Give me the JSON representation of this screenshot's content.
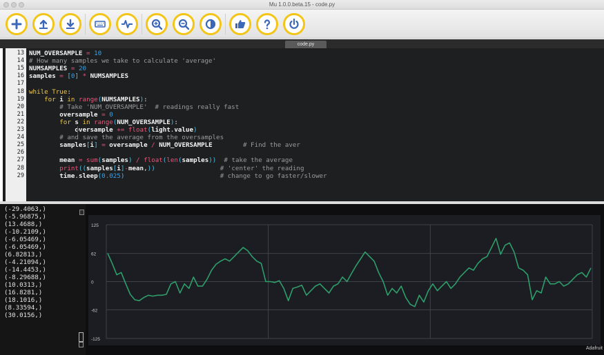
{
  "window": {
    "title": "Mu 1.0.0.beta.15 - code.py"
  },
  "toolbar": {
    "buttons": [
      {
        "name": "new",
        "icon": "plus-icon"
      },
      {
        "name": "load",
        "icon": "upload-icon"
      },
      {
        "name": "save",
        "icon": "download-icon"
      },
      {
        "name": "serial",
        "icon": "keyboard-icon"
      },
      {
        "name": "plotter",
        "icon": "pulse-icon"
      },
      {
        "name": "zoom-in",
        "icon": "zoom-in-icon"
      },
      {
        "name": "zoom-out",
        "icon": "zoom-out-icon"
      },
      {
        "name": "theme",
        "icon": "contrast-icon"
      },
      {
        "name": "check",
        "icon": "thumbs-up-icon"
      },
      {
        "name": "help",
        "icon": "question-icon"
      },
      {
        "name": "quit",
        "icon": "power-icon"
      }
    ],
    "accent_color": "#f2c518",
    "icon_color": "#3a67b8"
  },
  "tabs": [
    {
      "label": "code.py"
    }
  ],
  "editor": {
    "lines": [
      {
        "n": "13",
        "code": "NUM_OVERSAMPLE = 10"
      },
      {
        "n": "14",
        "code": "# How many samples we take to calculate 'average'"
      },
      {
        "n": "15",
        "code": "NUMSAMPLES = 20"
      },
      {
        "n": "16",
        "code": "samples = [0] * NUMSAMPLES"
      },
      {
        "n": "17",
        "code": ""
      },
      {
        "n": "18",
        "code": "while True:"
      },
      {
        "n": "19",
        "code": "    for i in range(NUMSAMPLES):"
      },
      {
        "n": "20",
        "code": "        # Take 'NUM_OVERSAMPLE'  # readings really fast"
      },
      {
        "n": "21",
        "code": "        oversample = 0"
      },
      {
        "n": "22",
        "code": "        for s in range(NUM_OVERSAMPLE):"
      },
      {
        "n": "23",
        "code": "            oversample += float(light.value)"
      },
      {
        "n": "24",
        "code": "        # and save the average from the oversamples"
      },
      {
        "n": "25",
        "code": "        samples[i] = oversample / NUM_OVERSAMPLE        # Find the aver"
      },
      {
        "n": "26",
        "code": ""
      },
      {
        "n": "27",
        "code": "        mean = sum(samples) / float(len(samples))  # take the average"
      },
      {
        "n": "28",
        "code": "        print((samples[i]-mean,))                 # 'center' the reading"
      },
      {
        "n": "29",
        "code": "        time.sleep(0.025)                         # change to go faster/slower"
      }
    ]
  },
  "repl": {
    "lines": [
      "(-29.4063,)",
      "(-5.96875,)",
      "(13.4688,)",
      "(-10.2109,)",
      "(-6.05469,)",
      "(-6.05469,)",
      "(6.82813,)",
      "(-4.21094,)",
      "(-14.4453,)",
      "(-8.29688,)",
      "(10.0313,)",
      "(16.8281,)",
      "(18.1016,)",
      "(8.33594,)",
      "(30.0156,)"
    ]
  },
  "status": {
    "text": "Adafruit"
  },
  "chart_data": {
    "type": "line",
    "ylim": [
      -125,
      125
    ],
    "yticks": [
      "125",
      "62",
      "0",
      "-62",
      "-125"
    ],
    "line_color": "#2e9e6a",
    "grid": true,
    "series": [
      {
        "values": [
          62,
          40,
          15,
          20,
          -5,
          -28,
          -40,
          -42,
          -35,
          -30,
          -32,
          -30,
          -30,
          -28,
          -5,
          0,
          -25,
          -5,
          -15,
          10,
          -10,
          -10,
          5,
          25,
          38,
          45,
          50,
          45,
          55,
          65,
          75,
          68,
          55,
          45,
          40,
          0,
          0,
          -2,
          2,
          -15,
          -42,
          -15,
          -12,
          -8,
          -30,
          -20,
          -10,
          -5,
          -15,
          -25,
          -10,
          -5,
          10,
          0,
          18,
          35,
          50,
          65,
          55,
          45,
          20,
          0,
          -30,
          -15,
          -25,
          -10,
          -35,
          -50,
          -55,
          -30,
          -45,
          -20,
          -5,
          -20,
          -10,
          0,
          -15,
          -5,
          10,
          20,
          30,
          25,
          40,
          50,
          55,
          75,
          95,
          60,
          80,
          85,
          65,
          30,
          25,
          15,
          -40,
          -20,
          -25,
          10,
          -5,
          -5,
          0,
          -10,
          -5,
          5,
          15,
          20,
          10,
          30
        ]
      }
    ]
  }
}
